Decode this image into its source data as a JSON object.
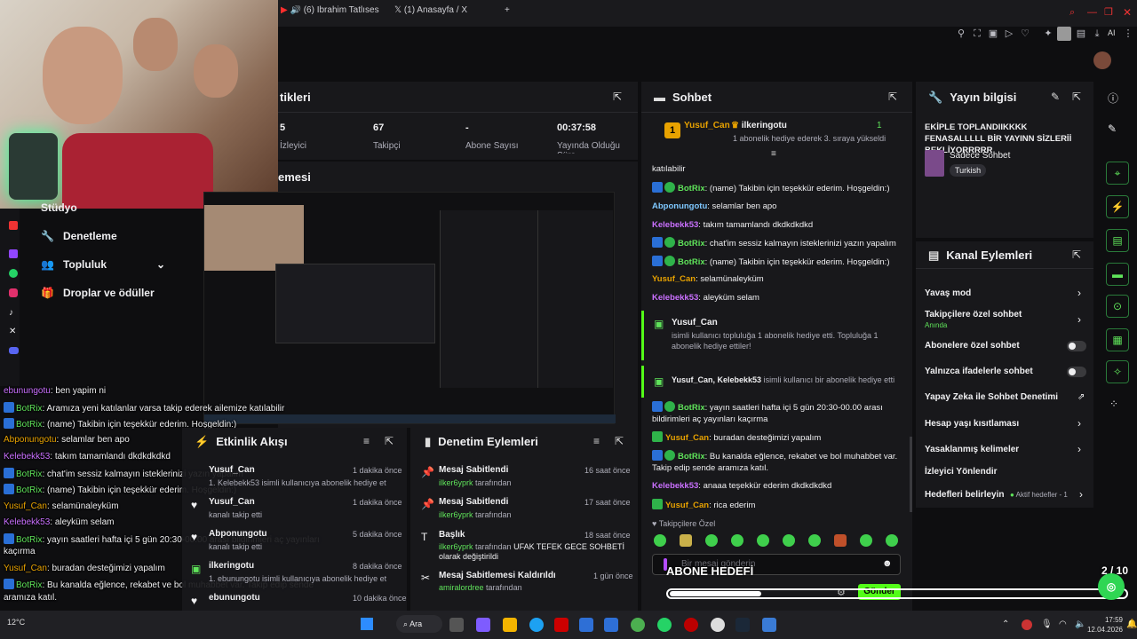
{
  "browser": {
    "tabs": [
      {
        "label": "(6) İbrahim Tatlıses - T"
      },
      {
        "label": "(1) Anasayfa / X"
      }
    ],
    "new_tab": "+",
    "ai_label": "AI"
  },
  "stats": {
    "title": "tikleri",
    "items": [
      {
        "value": "5",
        "label": "İzleyici"
      },
      {
        "value": "67",
        "label": "Takipçi"
      },
      {
        "value": "-",
        "label": "Abone Sayısı"
      },
      {
        "value": "00:37:58",
        "label": "Yayında Olduğu Süre"
      }
    ]
  },
  "preview": {
    "title": "emesi"
  },
  "sidebar": {
    "items": [
      {
        "label": "Stüdyo"
      },
      {
        "label": "Denetleme"
      },
      {
        "label": "Topluluk"
      },
      {
        "label": "Droplar ve ödüller"
      }
    ]
  },
  "chat": {
    "title": "Sohbet",
    "pinned_user": "Yusuf_Can",
    "pinned_rank": "1",
    "pinned_user2": "ilkeringotu",
    "pinned_rank2": "1",
    "pinned_note": "1 abonelik hediye ederek 3. sıraya yükseldi",
    "messages": [
      {
        "user": "",
        "text": "katılabilir",
        "color": "#efeff1"
      },
      {
        "user": "BotRix",
        "text": ": (name) Takibin için teşekkür ederim. Hoşgeldin:)",
        "color": "#5fe35a",
        "badge": true
      },
      {
        "user": "Abponungotu",
        "text": ": selamlar ben apo",
        "color": "#7ec8ff"
      },
      {
        "user": "Kelebekk53",
        "text": ": takım tamamlandı dkdkdkdkd",
        "color": "#ca70ff"
      },
      {
        "user": "BotRix",
        "text": ": chat'im sessiz kalmayın isteklerinizi yazın yapalım",
        "color": "#5fe35a",
        "badge": true
      },
      {
        "user": "BotRix",
        "text": ": (name) Takibin için teşekkür ederim. Hoşgeldin:)",
        "color": "#5fe35a",
        "badge": true
      },
      {
        "user": "Yusuf_Can",
        "text": ": selamünaleyküm",
        "color": "#e8a200"
      },
      {
        "user": "Kelebekk53",
        "text": ": aleyküm selam",
        "color": "#ca70ff"
      }
    ],
    "gift1": {
      "user": "Yusuf_Can",
      "text": "isimli kullanıcı topluluğa 1 abonelik hediye etti. Topluluğa 1 abonelik hediye ettiler!"
    },
    "gift2": {
      "user": "Yusuf_Can, Kelebekk53",
      "text": "isimli kullanıcı bir abonelik hediye etti"
    },
    "messages2": [
      {
        "user": "BotRix",
        "text": ": yayın saatleri hafta içi 5 gün 20:30-00.00 arası bildirimleri aç yayınları kaçırma",
        "color": "#5fe35a",
        "badge": true
      },
      {
        "user": "Yusuf_Can",
        "text": ": buradan desteğimizi yapalım",
        "color": "#e8a200"
      },
      {
        "user": "BotRix",
        "text": ": Bu kanalda eğlence, rekabet ve bol muhabbet var. Takip edip sende aramıza katıl.",
        "color": "#5fe35a",
        "badge": true
      },
      {
        "user": "Kelebekk53",
        "text": ": anaaa teşekkür ederim dkdkdkdkd",
        "color": "#ca70ff"
      },
      {
        "user": "Yusuf_Can",
        "text": ": rica ederim",
        "color": "#e8a200"
      }
    ],
    "followers_only": "Takipçilere Özel",
    "input_placeholder": "Bir mesaj gönderin",
    "send_label": "Gönder"
  },
  "stream_info": {
    "title": "Yayın bilgisi",
    "stream_title": "EKİPLE TOPLANDIIKKKK FENASALLLLL BİR YAYINN SİZLERİİ BEKLİYORRRRR",
    "category": "Sadece Sohbet",
    "tag": "Turkish"
  },
  "channel_actions": {
    "title": "Kanal Eylemleri",
    "items": [
      {
        "label": "Yavaş mod",
        "sub": "",
        "control": "chevron"
      },
      {
        "label": "Takipçilere özel sohbet",
        "sub": "Anında",
        "control": "chevron"
      },
      {
        "label": "Abonelere özel sohbet",
        "sub": "",
        "control": "toggle"
      },
      {
        "label": "Yalnızca ifadelerle sohbet",
        "sub": "",
        "control": "toggle"
      },
      {
        "label": "Yapay Zeka ile Sohbet Denetimi",
        "sub": "",
        "control": "external"
      },
      {
        "label": "Hesap yaşı kısıtlaması",
        "sub": "",
        "control": "chevron"
      },
      {
        "label": "Yasaklanmış kelimeler",
        "sub": "",
        "control": "chevron"
      },
      {
        "label": "İzleyici Yönlendir",
        "sub": "",
        "control": "none"
      },
      {
        "label": "Hedefleri belirleyin",
        "sub": "Aktif hedefler - 1",
        "control": "chevron"
      }
    ]
  },
  "activity": {
    "title": "Etkinlik Akışı",
    "items": [
      {
        "user": "Yusuf_Can",
        "desc": "1. Kelebekk53 isimli kullanıcıya abonelik hediye etti.",
        "time": "1 dakika önce"
      },
      {
        "user": "Yusuf_Can",
        "desc": "kanalı takip etti",
        "time": "1 dakika önce"
      },
      {
        "user": "Abponungotu",
        "desc": "kanalı takip etti",
        "time": "5 dakika önce"
      },
      {
        "user": "ilkeringotu",
        "desc": "1. ebunungotu isimli kullanıcıya abonelik hediye etti.",
        "time": "8 dakika önce"
      },
      {
        "user": "ebunungotu",
        "desc": "",
        "time": "10 dakika önce"
      }
    ]
  },
  "mod_actions": {
    "title": "Denetim Eylemleri",
    "items": [
      {
        "action": "Mesaj Sabitlendi",
        "by": "ilker6yprk",
        "suffix": "tarafından",
        "extra": "",
        "time": "16 saat önce"
      },
      {
        "action": "Mesaj Sabitlendi",
        "by": "ilker6yprk",
        "suffix": "tarafından",
        "extra": "",
        "time": "17 saat önce"
      },
      {
        "action": "Başlık",
        "by": "ilker6yprk",
        "suffix": "tarafından",
        "extra": "UFAK TEFEK GECE SOHBETİ olarak değiştirildi",
        "time": "18 saat önce"
      },
      {
        "action": "Mesaj Sabitlemesi Kaldırıldı",
        "by": "amiralordree",
        "suffix": "tarafından",
        "extra": "",
        "time": "1 gün önce"
      }
    ]
  },
  "overlay_chat": {
    "lines": [
      {
        "user": "ebunungotu",
        "text": ": ben yapim ni"
      },
      {
        "user": "BotRix",
        "text": ": Aramıza yeni katılanlar varsa takip ederek ailemize katılabilir"
      },
      {
        "user": "BotRix",
        "text": ": (name) Takibin için teşekkür ederim. Hoşgeldin:)"
      },
      {
        "user": "Abponungotu",
        "text": ": selamlar ben apo"
      },
      {
        "user": "Kelebekk53",
        "text": ": takım tamamlandı dkdkdkdkd"
      },
      {
        "user": "BotRix",
        "text": ": chat'im sessiz kalmayın isteklerinizi yazın yapalım"
      },
      {
        "user": "BotRix",
        "text": ": (name) Takibin için teşekkür ederim. Hoşgeldin:)"
      },
      {
        "user": "Yusuf_Can",
        "text": ": selamünaleyküm"
      },
      {
        "user": "Kelebekk53",
        "text": ": aleyküm selam"
      },
      {
        "user": "BotRix",
        "text": ": yayın saatleri hafta içi 5 gün 20:30-00.00 arası bildirimleri aç yayınları"
      },
      {
        "user": "",
        "text": "kaçırma"
      },
      {
        "user": "Yusuf_Can",
        "text": ": buradan desteğimizi yapalım"
      },
      {
        "user": "BotRix",
        "text": ": Bu kanalda eğlence, rekabet ve bol muhabbet var. Takip edip sende"
      },
      {
        "user": "",
        "text": "aramıza katıl."
      },
      {
        "user": "Kelebekk53",
        "text": ": anaaa teşekkür ederim dkdkdkdkd"
      },
      {
        "user": "Yusuf_Can",
        "text": ": rica ederim"
      }
    ]
  },
  "goal_overlay": {
    "label": "ABONE HEDEFİ",
    "progress": "2 / 10"
  },
  "taskbar": {
    "search": "Ara",
    "time": "17:59",
    "date": "12.04.2026",
    "temp": "12°C"
  },
  "colors": {
    "accent": "#53fc18",
    "panel": "#18181b",
    "bg": "#0e0e10"
  }
}
